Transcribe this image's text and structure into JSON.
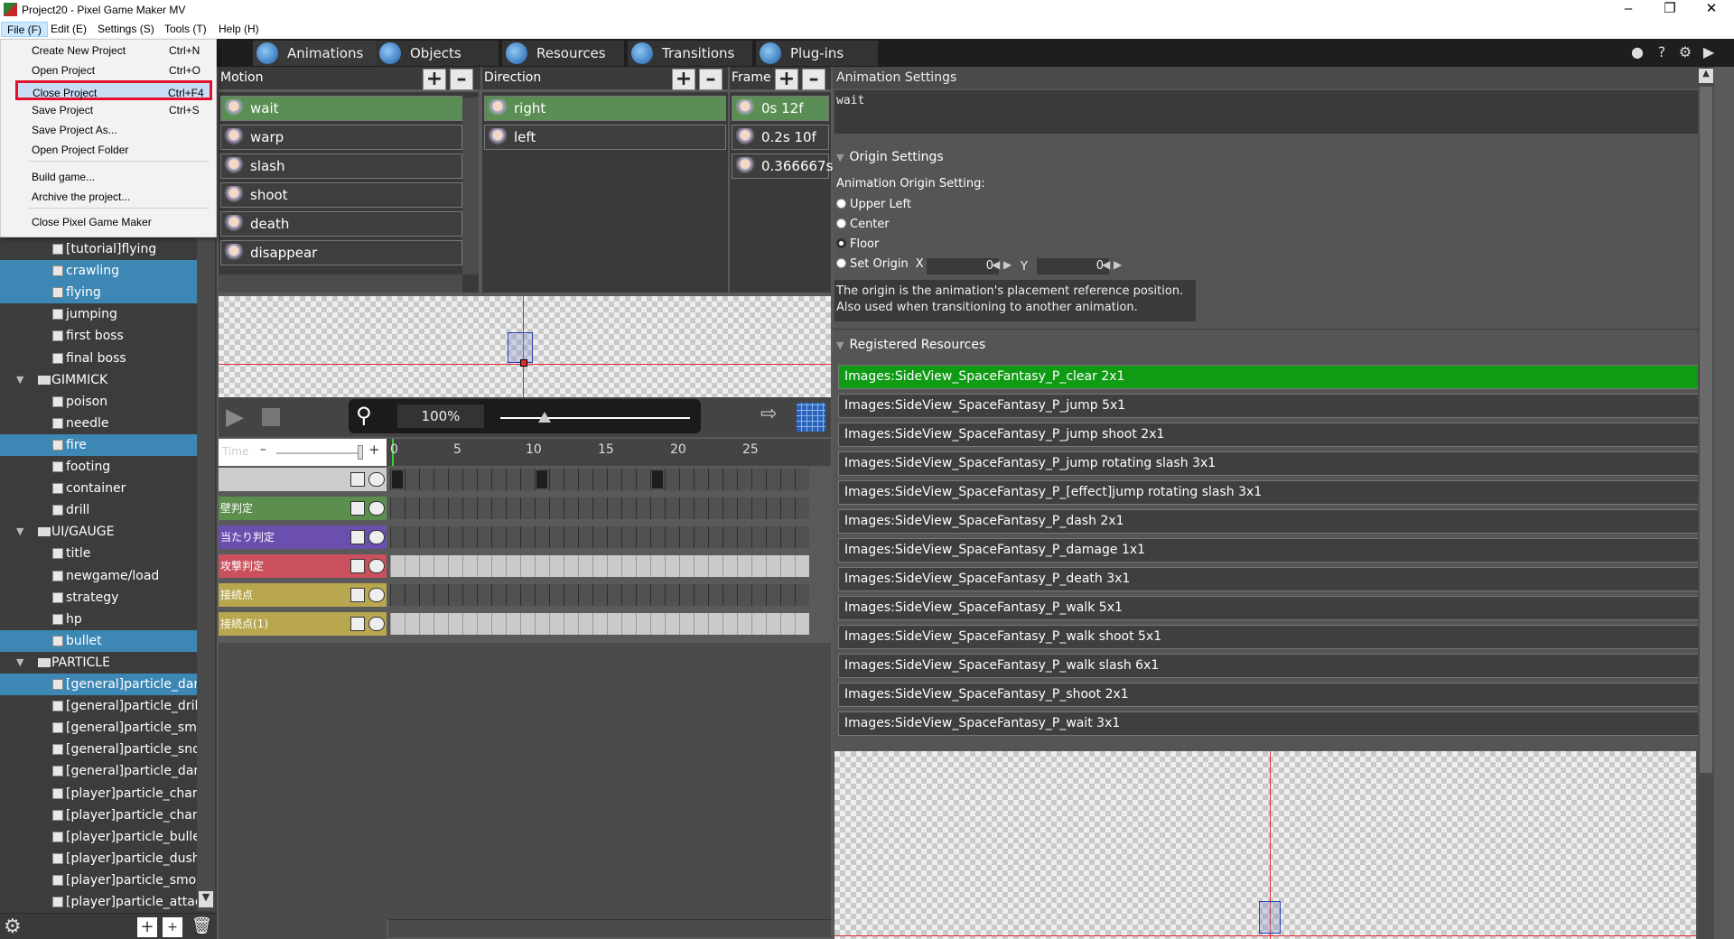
{
  "window": {
    "title": "Project20 - Pixel Game Maker MV"
  },
  "menubar": [
    "File (F)",
    "Edit (E)",
    "Settings (S)",
    "Tools (T)",
    "Help (H)"
  ],
  "file_menu": [
    {
      "label": "Create New Project",
      "shortcut": "Ctrl+N"
    },
    {
      "label": "Open Project",
      "shortcut": "Ctrl+O"
    },
    {
      "label": "Close Project",
      "shortcut": "Ctrl+F4"
    },
    {
      "label": "Save Project",
      "shortcut": "Ctrl+S"
    },
    {
      "label": "Save Project As...",
      "shortcut": ""
    },
    {
      "label": "Open Project Folder",
      "shortcut": ""
    },
    {
      "label": "Build game...",
      "shortcut": ""
    },
    {
      "label": "Archive the project...",
      "shortcut": ""
    },
    {
      "label": "Close Pixel Game Maker",
      "shortcut": ""
    }
  ],
  "tabs": [
    "Animations",
    "Objects",
    "Resources",
    "Transitions",
    "Plug-ins"
  ],
  "tree": [
    {
      "label": "[tutorial]flying",
      "sel": false,
      "kind": "item"
    },
    {
      "label": "crawling",
      "sel": true,
      "kind": "item"
    },
    {
      "label": "flying",
      "sel": true,
      "kind": "item"
    },
    {
      "label": "jumping",
      "sel": false,
      "kind": "item"
    },
    {
      "label": "first boss",
      "sel": false,
      "kind": "item"
    },
    {
      "label": "final boss",
      "sel": false,
      "kind": "item"
    },
    {
      "label": "GIMMICK",
      "sel": false,
      "kind": "folder"
    },
    {
      "label": "poison",
      "sel": false,
      "kind": "item"
    },
    {
      "label": "needle",
      "sel": false,
      "kind": "item"
    },
    {
      "label": "fire",
      "sel": true,
      "kind": "item"
    },
    {
      "label": "footing",
      "sel": false,
      "kind": "item"
    },
    {
      "label": "container",
      "sel": false,
      "kind": "item"
    },
    {
      "label": "drill",
      "sel": false,
      "kind": "item"
    },
    {
      "label": "UI/GAUGE",
      "sel": false,
      "kind": "folder"
    },
    {
      "label": "title",
      "sel": false,
      "kind": "item"
    },
    {
      "label": "newgame/load",
      "sel": false,
      "kind": "item"
    },
    {
      "label": "strategy",
      "sel": false,
      "kind": "item"
    },
    {
      "label": "hp",
      "sel": false,
      "kind": "item"
    },
    {
      "label": "bullet",
      "sel": true,
      "kind": "item"
    },
    {
      "label": "PARTICLE",
      "sel": false,
      "kind": "folder"
    },
    {
      "label": "[general]particle_dama",
      "sel": true,
      "kind": "item"
    },
    {
      "label": "[general]particle_drill",
      "sel": false,
      "kind": "item"
    },
    {
      "label": "[general]particle_smo",
      "sel": false,
      "kind": "item"
    },
    {
      "label": "[general]particle_snov",
      "sel": false,
      "kind": "item"
    },
    {
      "label": "[general]particle_dama",
      "sel": false,
      "kind": "item"
    },
    {
      "label": "[player]particle_charg",
      "sel": false,
      "kind": "item"
    },
    {
      "label": "[player]particle_charg",
      "sel": false,
      "kind": "item"
    },
    {
      "label": "[player]particle_bullet",
      "sel": false,
      "kind": "item"
    },
    {
      "label": "[player]particle_dush",
      "sel": false,
      "kind": "item"
    },
    {
      "label": "[player]particle_smok",
      "sel": false,
      "kind": "item"
    },
    {
      "label": "[player]particle_attac",
      "sel": false,
      "kind": "item"
    }
  ],
  "motion": {
    "header": "Motion",
    "items": [
      "wait",
      "warp",
      "slash",
      "shoot",
      "death",
      "disappear"
    ]
  },
  "direction": {
    "header": "Direction",
    "items": [
      "right",
      "left"
    ]
  },
  "frame": {
    "header": "Frame",
    "items": [
      "0s 12f",
      "0.2s 10f",
      "0.366667s"
    ]
  },
  "zoom": "100%",
  "time_label": "Time",
  "timeline": {
    "ticks": [
      "0",
      "5",
      "10",
      "15",
      "20",
      "25"
    ]
  },
  "tracks": [
    {
      "label": "",
      "color": "#cdcdcd",
      "light": false
    },
    {
      "label": "壁判定",
      "color": "#5c8e4e",
      "light": false
    },
    {
      "label": "当たり判定",
      "color": "#6a4fae",
      "light": false
    },
    {
      "label": "攻撃判定",
      "color": "#c9505c",
      "light": true
    },
    {
      "label": "接続点",
      "color": "#b8a74e",
      "light": false
    },
    {
      "label": "接続点(1)",
      "color": "#b8a74e",
      "light": true
    }
  ],
  "settings": {
    "header": "Animation Settings",
    "name_value": "wait",
    "origin_header": "Origin Settings",
    "origin_label": "Animation Origin Setting:",
    "options": [
      "Upper Left",
      "Center",
      "Floor",
      "Set Origin"
    ],
    "selected": "Floor",
    "x_label": "X",
    "x_value": "0",
    "y_label": "Y",
    "y_value": "0",
    "note_line1": "The origin is the animation's placement reference position.",
    "note_line2": "Also used when transitioning to another animation.",
    "resources_header": "Registered Resources",
    "resources": [
      "Images:SideView_SpaceFantasy_P_clear 2x1",
      "Images:SideView_SpaceFantasy_P_jump 5x1",
      "Images:SideView_SpaceFantasy_P_jump shoot 2x1",
      "Images:SideView_SpaceFantasy_P_jump rotating slash 3x1",
      "Images:SideView_SpaceFantasy_P_[effect]jump rotating slash 3x1",
      "Images:SideView_SpaceFantasy_P_dash 2x1",
      "Images:SideView_SpaceFantasy_P_damage 1x1",
      "Images:SideView_SpaceFantasy_P_death 3x1",
      "Images:SideView_SpaceFantasy_P_walk 5x1",
      "Images:SideView_SpaceFantasy_P_walk shoot 5x1",
      "Images:SideView_SpaceFantasy_P_walk slash 6x1",
      "Images:SideView_SpaceFantasy_P_shoot 2x1",
      "Images:SideView_SpaceFantasy_P_wait 3x1"
    ]
  },
  "colors": {
    "selected_resource": "#109b14",
    "highlight_box": "#e2102d",
    "tree_selected": "#3d87b5"
  }
}
